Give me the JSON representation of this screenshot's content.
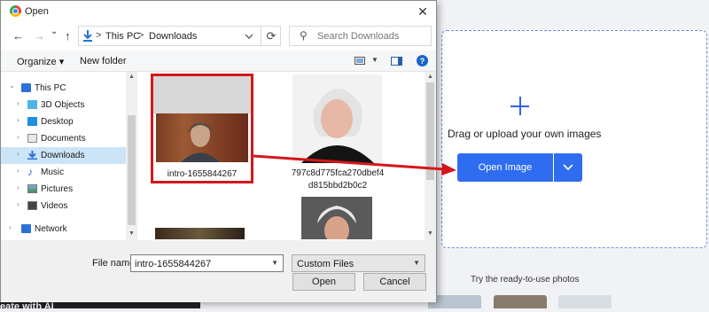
{
  "dialog": {
    "title": "Open",
    "close_glyph": "✕",
    "nav": {
      "back": "←",
      "forward": "→",
      "recent": "⌄",
      "up": "↑"
    },
    "breadcrumb": [
      "This PC",
      "Downloads"
    ],
    "breadcrumb_separator": ">",
    "search_placeholder": "Search Downloads",
    "toolbar": {
      "organize": "Organize ▾",
      "new_folder": "New folder",
      "help": "?"
    },
    "sidebar": [
      {
        "label": "This PC",
        "icon": "pc-icon"
      },
      {
        "label": "3D Objects",
        "icon": "cube-icon"
      },
      {
        "label": "Desktop",
        "icon": "desktop-icon"
      },
      {
        "label": "Documents",
        "icon": "documents-icon"
      },
      {
        "label": "Downloads",
        "icon": "download-icon",
        "selected": true
      },
      {
        "label": "Music",
        "icon": "music-icon"
      },
      {
        "label": "Pictures",
        "icon": "pictures-icon"
      },
      {
        "label": "Videos",
        "icon": "videos-icon"
      },
      {
        "label": "Network",
        "icon": "network-icon"
      }
    ],
    "files": [
      {
        "name": "intro-1655844267",
        "selected": true
      },
      {
        "name_line1": "797c8d775fca270dbef4",
        "name_line2": "d815bbd2b0c2"
      }
    ],
    "file_name_label": "File name:",
    "file_name_value": "intro-1655844267",
    "file_type": "Custom Files",
    "open_button": "Open",
    "cancel_button": "Cancel"
  },
  "page": {
    "drag_text": "Drag or upload your own images",
    "open_image_button": "Open Image",
    "ready_text": "Try the ready-to-use photos",
    "left_strip_text": "eate with AI"
  },
  "colors": {
    "accent": "#2f6df0",
    "selection_box": "#d4171b",
    "annotation_arrow": "#d4171b"
  }
}
